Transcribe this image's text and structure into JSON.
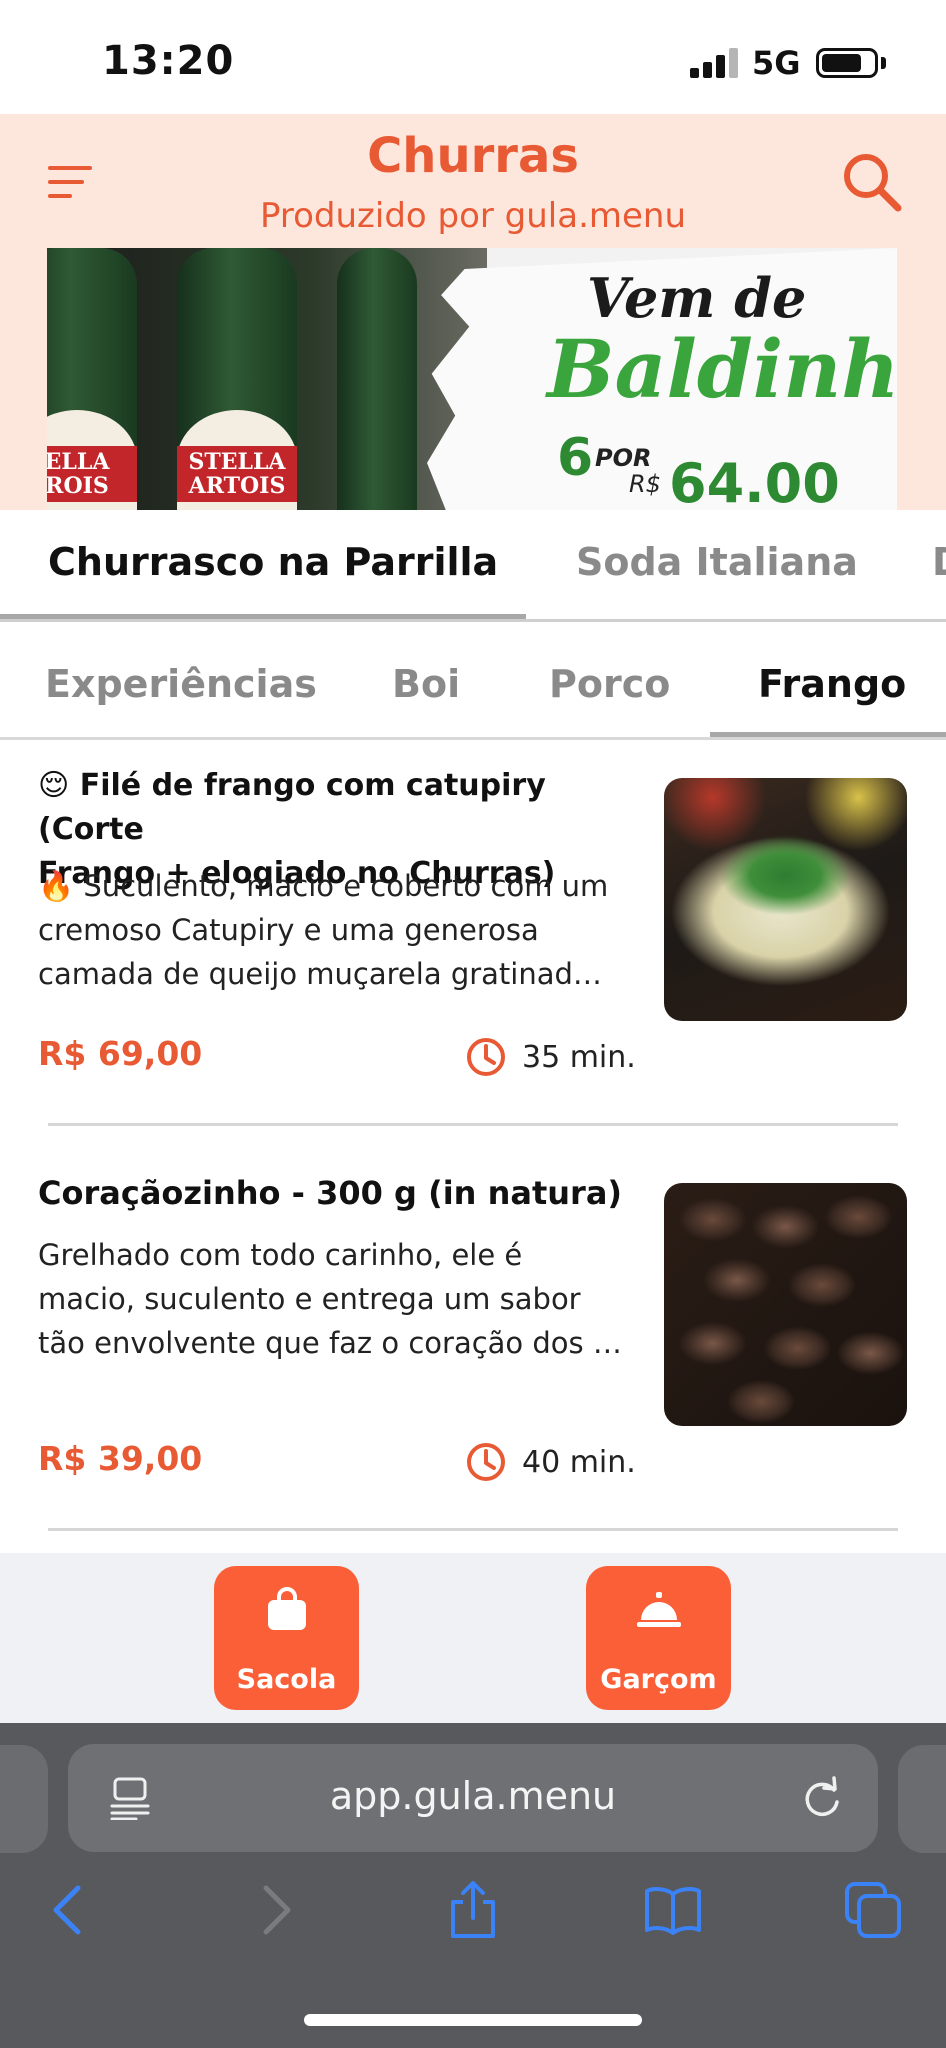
{
  "status_bar": {
    "time": "13:20",
    "network": "5G",
    "battery_level": 0.78
  },
  "header": {
    "title": "Churras",
    "subtitle": "Produzido por gula.menu"
  },
  "banner": {
    "bottle_label": "STELLA ARTOIS",
    "bottle_label_left": "ELLA ROIS",
    "line1": "Vem de",
    "line2": "Baldinho!",
    "quantity": "6",
    "por": "POR",
    "currency": "R$",
    "price": "64.00"
  },
  "main_tabs": [
    {
      "label": "Churrasco na Parrilla",
      "active": true
    },
    {
      "label": "Soda Italiana",
      "active": false
    },
    {
      "label": "D",
      "active": false
    }
  ],
  "sub_tabs": [
    {
      "label": "Experiências",
      "active": false
    },
    {
      "label": "Boi",
      "active": false
    },
    {
      "label": "Porco",
      "active": false
    },
    {
      "label": "Frango",
      "active": true
    }
  ],
  "items": [
    {
      "title_line1": "😌 Filé de frango com catupiry (Corte",
      "title_line2": "Frango + elogiado no Churras)",
      "desc_line1": "🔥 Suculento, macio e coberto com um",
      "desc_line2": "cremoso Catupiry e uma generosa",
      "desc_line3": "camada de queijo muçarela gratinad…",
      "price": "R$ 69,00",
      "time": "35 min.",
      "photo_icon": "grilled-chicken-photo"
    },
    {
      "title_line1": "Coraçãozinho - 300 g (in natura)",
      "desc_line1": "Grelhado com todo carinho, ele é",
      "desc_line2": "macio, suculento e entrega um sabor",
      "desc_line3": "tão envolvente que faz o coração dos …",
      "price": "R$ 39,00",
      "time": "40 min.",
      "photo_icon": "chicken-hearts-skewers-photo"
    }
  ],
  "actions": {
    "bag_label": "Sacola",
    "waiter_label": "Garçom"
  },
  "browser": {
    "url": "app.gula.menu"
  },
  "colors": {
    "accent": "#e85a34",
    "button": "#fa5f38",
    "header_bg": "#fde6dc",
    "browser_blue": "#3b82f6"
  }
}
